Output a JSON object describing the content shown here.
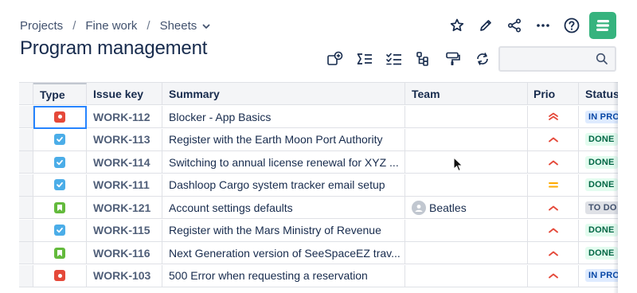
{
  "breadcrumb": {
    "items": [
      "Projects",
      "Fine work",
      "Sheets"
    ],
    "separator": "/"
  },
  "page": {
    "title": "Program management"
  },
  "search": {
    "placeholder": "",
    "value": ""
  },
  "table": {
    "columns": [
      "Type",
      "Issue key",
      "Summary",
      "Team",
      "Prio",
      "Status"
    ],
    "rows": [
      {
        "type": "bug",
        "key": "WORK-112",
        "summary": "Blocker - App Basics",
        "team": "",
        "prio": "highest",
        "status": "IN PROGRESS"
      },
      {
        "type": "task",
        "key": "WORK-113",
        "summary": "Register with the Earth Moon Port Authority",
        "team": "",
        "prio": "high",
        "status": "DONE"
      },
      {
        "type": "task",
        "key": "WORK-114",
        "summary": "Switching to annual license renewal for XYZ ...",
        "team": "",
        "prio": "high",
        "status": "DONE"
      },
      {
        "type": "task",
        "key": "WORK-111",
        "summary": "Dashloop Cargo system tracker email setup",
        "team": "",
        "prio": "medium",
        "status": "DONE"
      },
      {
        "type": "story",
        "key": "WORK-121",
        "summary": "Account settings defaults",
        "team": "Beatles",
        "prio": "high",
        "status": "TO DO"
      },
      {
        "type": "task",
        "key": "WORK-115",
        "summary": "Register with the Mars Ministry of Revenue",
        "team": "",
        "prio": "high",
        "status": "DONE"
      },
      {
        "type": "story",
        "key": "WORK-116",
        "summary": "Next Generation version of SeeSpaceEZ trav...",
        "team": "",
        "prio": "high",
        "status": "DONE"
      },
      {
        "type": "bug",
        "key": "WORK-103",
        "summary": "500 Error when requesting a reservation",
        "team": "",
        "prio": "high",
        "status": "IN PROGRESS"
      }
    ]
  },
  "colors": {
    "accent": "#2684ff",
    "high": "#e5493a",
    "medium": "#ffab00",
    "logo": "#36b37e"
  }
}
